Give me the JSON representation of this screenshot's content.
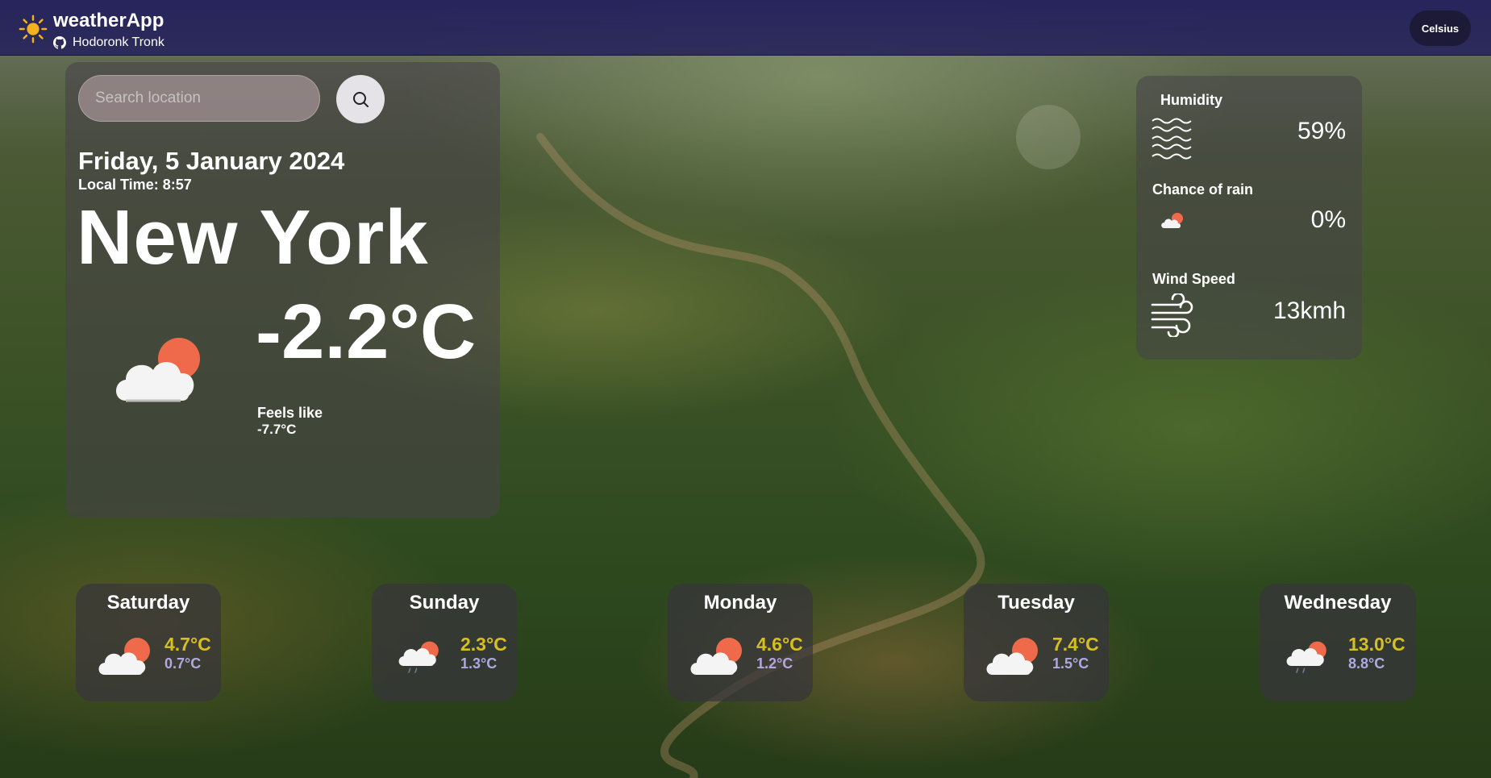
{
  "header": {
    "app_title": "weatherApp",
    "author": "Hodoronk Tronk",
    "unit_toggle": "Celsius",
    "logo_icon": "sun-icon",
    "author_icon": "github-icon"
  },
  "search": {
    "placeholder": "Search location",
    "value": "",
    "button_icon": "search-icon"
  },
  "current": {
    "date": "Friday, 5 January 2024",
    "local_time": "Local Time: 8:57",
    "city": "New York",
    "temperature": "-2.2°C",
    "feels_like_label": "Feels like",
    "feels_like_value": "-7.7°C",
    "condition_icon": "cloud-sun-icon"
  },
  "details": {
    "humidity": {
      "label": "Humidity",
      "value": "59%",
      "icon": "humidity-waves-icon"
    },
    "rain": {
      "label": "Chance of rain",
      "value": "0%",
      "icon": "cloud-sun-icon"
    },
    "wind": {
      "label": "Wind Speed",
      "value": "13kmh",
      "icon": "wind-icon"
    }
  },
  "forecast": [
    {
      "day": "Saturday",
      "max": "4.7°C",
      "min": "0.7°C",
      "icon": "cloud-sun-icon"
    },
    {
      "day": "Sunday",
      "max": "2.3°C",
      "min": "1.3°C",
      "icon": "cloud-sun-rain-icon"
    },
    {
      "day": "Monday",
      "max": "4.6°C",
      "min": "1.2°C",
      "icon": "cloud-sun-icon"
    },
    {
      "day": "Tuesday",
      "max": "7.4°C",
      "min": "1.5°C",
      "icon": "cloud-sun-icon"
    },
    {
      "day": "Wednesday",
      "max": "13.0°C",
      "min": "8.8°C",
      "icon": "cloud-sun-rain-icon"
    }
  ],
  "colors": {
    "header_bg": "#24215c",
    "max_temp": "#d6c020",
    "min_temp": "#b0a8e0",
    "sun": "#ee6a4a"
  }
}
